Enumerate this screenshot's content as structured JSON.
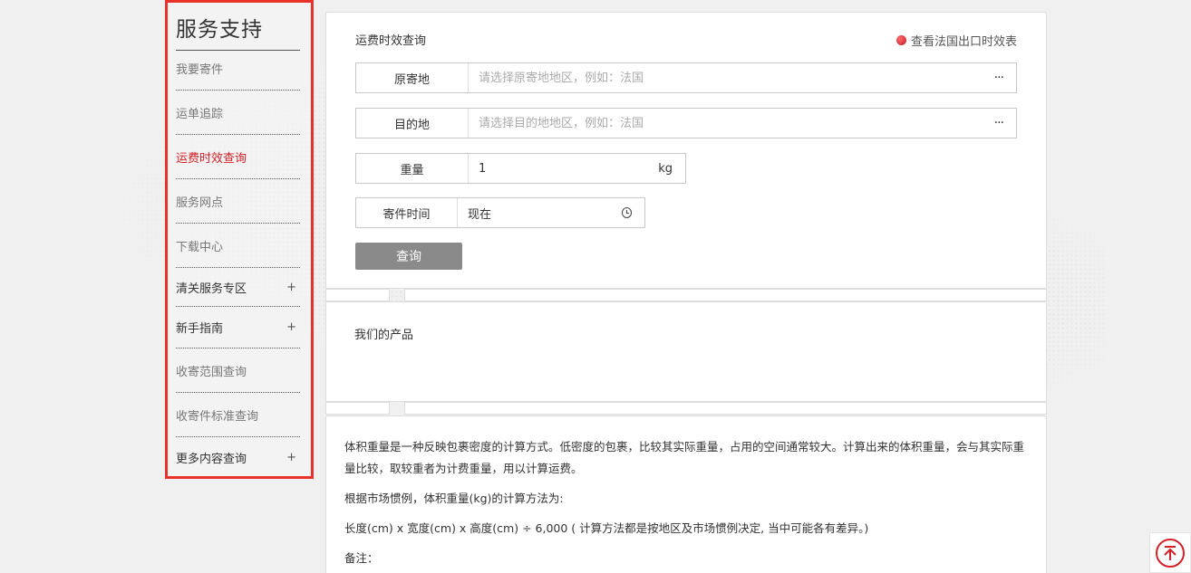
{
  "sidebar": {
    "title": "服务支持",
    "items": [
      {
        "label": "我要寄件",
        "expandable": false
      },
      {
        "label": "运单追踪",
        "expandable": false
      },
      {
        "label": "运费时效查询",
        "expandable": false,
        "active": true
      },
      {
        "label": "服务网点",
        "expandable": false
      },
      {
        "label": "下载中心",
        "expandable": false
      },
      {
        "label": "清关服务专区",
        "expandable": true
      },
      {
        "label": "新手指南",
        "expandable": true
      },
      {
        "label": "收寄范围查询",
        "expandable": false
      },
      {
        "label": "收寄件标准查询",
        "expandable": false
      },
      {
        "label": "更多内容查询",
        "expandable": true
      }
    ],
    "expand_symbol": "+"
  },
  "query": {
    "heading": "运费时效查询",
    "export_link": "查看法国出口时效表",
    "origin": {
      "label": "原寄地",
      "placeholder": "请选择原寄地地区，例如：法国",
      "value": ""
    },
    "destination": {
      "label": "目的地",
      "placeholder": "请选择目的地地区，例如：法国",
      "value": ""
    },
    "weight": {
      "label": "重量",
      "value": "1",
      "unit": "kg"
    },
    "send_time": {
      "label": "寄件时间",
      "value": "现在"
    },
    "more_symbol": "···",
    "submit_label": "查询"
  },
  "products": {
    "title": "我们的产品"
  },
  "description": {
    "para1": "体积重量是一种反映包裹密度的计算方式。低密度的包裹，比较其实际重量，占用的空间通常较大。计算出来的体积重量，会与其实际重量比较，取较重者为计费重量，用以计算运费。",
    "para2": "根据市场惯例，体积重量(kg)的计算方法为:",
    "para3": "长度(cm) x 宽度(cm) x 高度(cm) ÷ 6,000 ( 计算方法都是按地区及市场惯例决定, 当中可能各有差异。)",
    "para4": "备注："
  },
  "colors": {
    "accent_red": "#d71f26",
    "sidebar_border": "#e8332a",
    "button_gray": "#8a8a8a"
  }
}
